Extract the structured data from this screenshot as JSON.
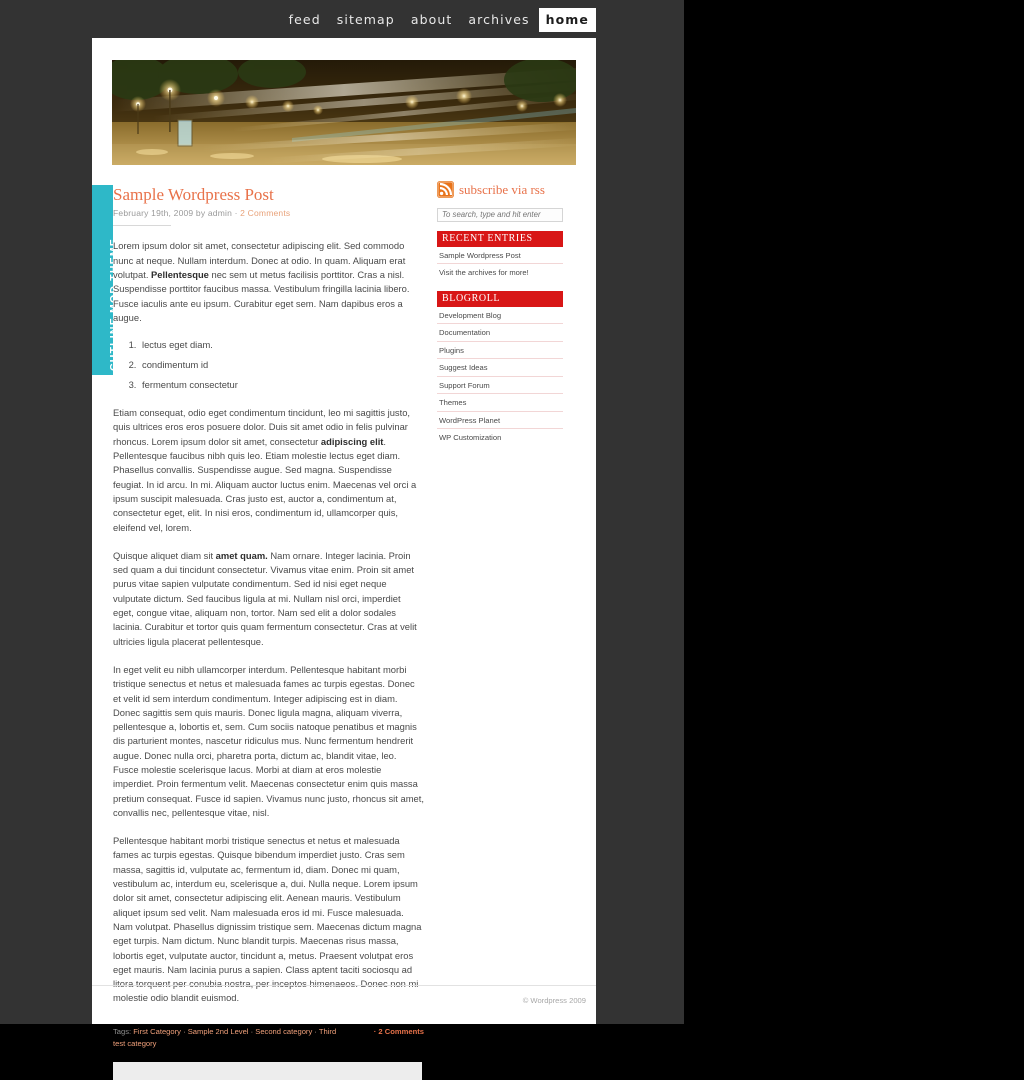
{
  "nav": {
    "items": [
      {
        "label": "feed",
        "active": false
      },
      {
        "label": "sitemap",
        "active": false
      },
      {
        "label": "about",
        "active": false
      },
      {
        "label": "archives",
        "active": false
      },
      {
        "label": "home",
        "active": true
      }
    ]
  },
  "theme_tab": {
    "label": "CUTLINE MOD THEME"
  },
  "post": {
    "title": "Sample Wordpress Post",
    "meta_date": "February 19th, 2009 by admin",
    "meta_sep": "·",
    "comments": "2 Comments",
    "paragraphs": [
      {
        "parts": [
          {
            "t": "Lorem ipsum dolor sit amet, consectetur adipiscing elit. Sed commodo nunc at neque. Nullam interdum. Donec at odio. In quam. Aliquam erat volutpat. ",
            "b": false
          },
          {
            "t": "Pellentesque",
            "b": true
          },
          {
            "t": " nec sem ut metus facilisis porttitor. Cras a nisl. Suspendisse porttitor faucibus massa. Vestibulum fringilla lacinia libero. Fusce iaculis ante eu ipsum. Curabitur eget sem. Nam dapibus eros a augue.",
            "b": false
          }
        ]
      },
      {
        "parts": [
          {
            "t": "Etiam consequat, odio eget condimentum tincidunt, leo mi sagittis justo, quis ultrices eros eros posuere dolor. Duis sit amet odio in felis pulvinar rhoncus. Lorem ipsum dolor sit amet, consectetur ",
            "b": false
          },
          {
            "t": "adipiscing elit",
            "b": true
          },
          {
            "t": ". Pellentesque faucibus nibh quis leo. Etiam molestie lectus eget diam. Phasellus convallis. Suspendisse augue. Sed magna. Suspendisse feugiat. In id arcu. In mi. Aliquam auctor luctus enim. Maecenas vel orci a ipsum suscipit malesuada. Cras justo est, auctor a, condimentum at, consectetur eget, elit. In nisi eros, condimentum id, ullamcorper quis, eleifend vel, lorem.",
            "b": false
          }
        ]
      },
      {
        "parts": [
          {
            "t": "Quisque aliquet diam sit ",
            "b": false
          },
          {
            "t": "amet quam.",
            "b": true
          },
          {
            "t": " Nam ornare. Integer lacinia. Proin sed quam a dui tincidunt consectetur. Vivamus vitae enim. Proin sit amet purus vitae sapien vulputate condimentum. Sed id nisi eget neque vulputate dictum. Sed faucibus ligula at mi. Nullam nisl orci, imperdiet eget, congue vitae, aliquam non, tortor. Nam sed elit a dolor sodales lacinia. Curabitur et tortor quis quam fermentum consectetur. Cras at velit ultricies ligula placerat pellentesque.",
            "b": false
          }
        ]
      },
      {
        "parts": [
          {
            "t": "In eget velit eu nibh ullamcorper interdum. Pellentesque habitant morbi tristique senectus et netus et malesuada fames ac turpis egestas. Donec et velit id sem interdum condimentum. Integer adipiscing est in diam. Donec sagittis sem quis mauris. Donec ligula magna, aliquam viverra, pellentesque a, lobortis et, sem. Cum sociis natoque penatibus et magnis dis parturient montes, nascetur ridiculus mus. Nunc fermentum hendrerit augue. Donec nulla orci, pharetra porta, dictum ac, blandit vitae, leo. Fusce molestie scelerisque lacus. Morbi at diam at eros molestie imperdiet. Proin fermentum velit. Maecenas consectetur enim quis massa pretium consequat. Fusce id sapien. Vivamus nunc justo, rhoncus sit amet, convallis nec, pellentesque vitae, nisl.",
            "b": false
          }
        ]
      },
      {
        "parts": [
          {
            "t": "Pellentesque habitant morbi tristique senectus et netus et malesuada fames ac turpis egestas. Quisque bibendum imperdiet justo. Cras sem massa, sagittis id, vulputate ac, fermentum id, diam. Donec mi quam, vestibulum ac, interdum eu, scelerisque a, dui. Nulla neque. Lorem ipsum dolor sit amet, consectetur adipiscing elit. Aenean mauris. Vestibulum aliquet ipsum sed velit. Nam malesuada eros id mi. Fusce malesuada. Nam volutpat. Phasellus dignissim tristique sem. Maecenas dictum magna eget turpis. Nam dictum. Nunc blandit turpis. Maecenas risus massa, lobortis eget, vulputate auctor, tincidunt a, metus. Praesent volutpat eros eget mauris. Nam lacinia purus a sapien. Class aptent taciti sociosqu ad litora torquent per conubia nostra, per inceptos himenaeos. Donec non mi molestie odio blandit euismod.",
            "b": false
          }
        ]
      }
    ],
    "ordered_list": [
      "lectus eget diam.",
      "condimentum id",
      "fermentum consectetur"
    ],
    "tags_label": "Tags:",
    "tags": [
      "First Category",
      "Sample 2nd Level",
      "Second category",
      "Third test category"
    ],
    "tags_comments": "· 2 Comments"
  },
  "sidebar": {
    "rss_label": "subscribe via rss",
    "rss_icon": "rss-icon",
    "search_placeholder": "To search, type and hit enter",
    "search_value": "",
    "sections": [
      {
        "heading": "RECENT ENTRIES",
        "items": [
          "Sample Wordpress Post",
          "Visit the archives for more!"
        ]
      },
      {
        "heading": "BLOGROLL",
        "items": [
          "Development Blog",
          "Documentation",
          "Plugins",
          "Suggest Ideas",
          "Support Forum",
          "Themes",
          "WordPress Planet",
          "WP Customization"
        ]
      }
    ]
  },
  "footer": {
    "text": "© Wordpress 2009"
  },
  "colors": {
    "accent_orange": "#e8724a",
    "accent_red": "#d81616",
    "accent_teal": "#2eb8c8",
    "nav_bg": "#333333"
  }
}
